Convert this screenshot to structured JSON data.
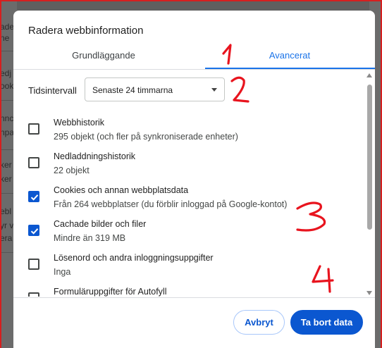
{
  "dialog": {
    "title": "Radera webbinformation",
    "tabs": [
      {
        "label": "Grundläggande",
        "active": false
      },
      {
        "label": "Avancerat",
        "active": true
      }
    ],
    "time_range": {
      "label": "Tidsintervall",
      "selected": "Senaste 24 timmarna"
    },
    "items": [
      {
        "title": "Webbhistorik",
        "subtitle": "295 objekt (och fler på synkroniserade enheter)",
        "checked": false
      },
      {
        "title": "Nedladdningshistorik",
        "subtitle": "22 objekt",
        "checked": false
      },
      {
        "title": "Cookies och annan webbplatsdata",
        "subtitle": "Från 264 webbplatser (du förblir inloggad på Google-kontot)",
        "checked": true
      },
      {
        "title": "Cachade bilder och filer",
        "subtitle": "Mindre än 319 MB",
        "checked": true
      },
      {
        "title": "Lösenord och andra inloggningsuppgifter",
        "subtitle": "Inga",
        "checked": false
      },
      {
        "title": "Formuläruppgifter för Autofyll",
        "subtitle": "",
        "checked": false
      }
    ],
    "buttons": {
      "cancel": "Avbryt",
      "delete": "Ta bort data"
    }
  },
  "colors": {
    "accent": "#0b57d0",
    "tab_active": "#1a73e8",
    "annotation": "#e8141e"
  },
  "annotations": [
    "1",
    "2",
    "3",
    "4"
  ]
}
